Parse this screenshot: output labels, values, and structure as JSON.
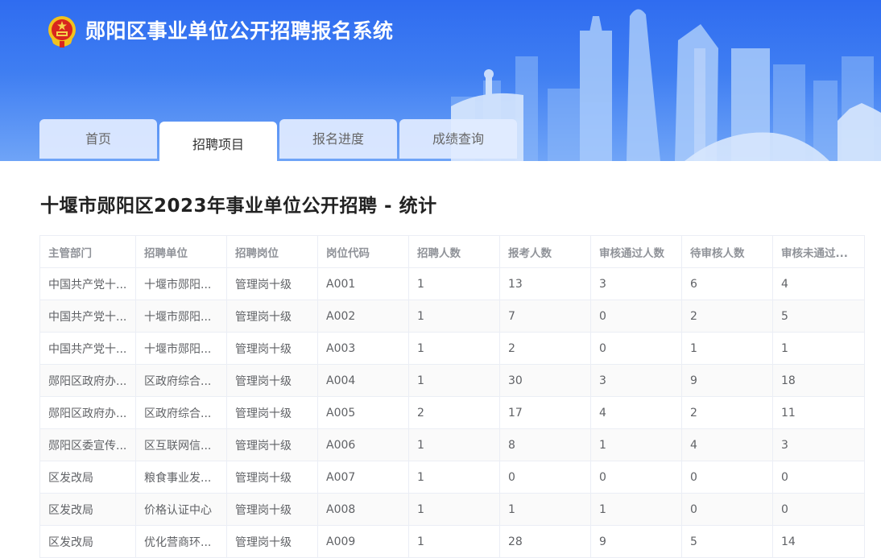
{
  "header": {
    "title": "郧阳区事业单位公开招聘报名系统"
  },
  "tabs": [
    {
      "label": "首页",
      "active": false
    },
    {
      "label": "招聘项目",
      "active": true
    },
    {
      "label": "报名进度",
      "active": false
    },
    {
      "label": "成绩查询",
      "active": false
    }
  ],
  "page_title": "十堰市郧阳区2023年事业单位公开招聘 - 统计",
  "table": {
    "headers": [
      "主管部门",
      "招聘单位",
      "招聘岗位",
      "岗位代码",
      "招聘人数",
      "报考人数",
      "审核通过人数",
      "待审核人数",
      "审核未通过..."
    ],
    "rows": [
      [
        "中国共产党十...",
        "十堰市郧阳...",
        "管理岗十级",
        "A001",
        "1",
        "13",
        "3",
        "6",
        "4"
      ],
      [
        "中国共产党十...",
        "十堰市郧阳...",
        "管理岗十级",
        "A002",
        "1",
        "7",
        "0",
        "2",
        "5"
      ],
      [
        "中国共产党十...",
        "十堰市郧阳...",
        "管理岗十级",
        "A003",
        "1",
        "2",
        "0",
        "1",
        "1"
      ],
      [
        "郧阳区政府办...",
        "区政府综合...",
        "管理岗十级",
        "A004",
        "1",
        "30",
        "3",
        "9",
        "18"
      ],
      [
        "郧阳区政府办...",
        "区政府综合...",
        "管理岗十级",
        "A005",
        "2",
        "17",
        "4",
        "2",
        "11"
      ],
      [
        "郧阳区委宣传...",
        "区互联网信...",
        "管理岗十级",
        "A006",
        "1",
        "8",
        "1",
        "4",
        "3"
      ],
      [
        "区发改局",
        "粮食事业发...",
        "管理岗十级",
        "A007",
        "1",
        "0",
        "0",
        "0",
        "0"
      ],
      [
        "区发改局",
        "价格认证中心",
        "管理岗十级",
        "A008",
        "1",
        "1",
        "1",
        "0",
        "0"
      ],
      [
        "区发改局",
        "优化营商环...",
        "管理岗十级",
        "A009",
        "1",
        "28",
        "9",
        "5",
        "14"
      ]
    ]
  },
  "colors": {
    "banner_top": "#2f6cf0",
    "banner_bottom": "#6fa4f7",
    "tab_bg": "#e2ecff",
    "header_text": "#909399",
    "cell_text": "#606266"
  },
  "icons": {
    "emblem": "national-emblem-icon"
  }
}
